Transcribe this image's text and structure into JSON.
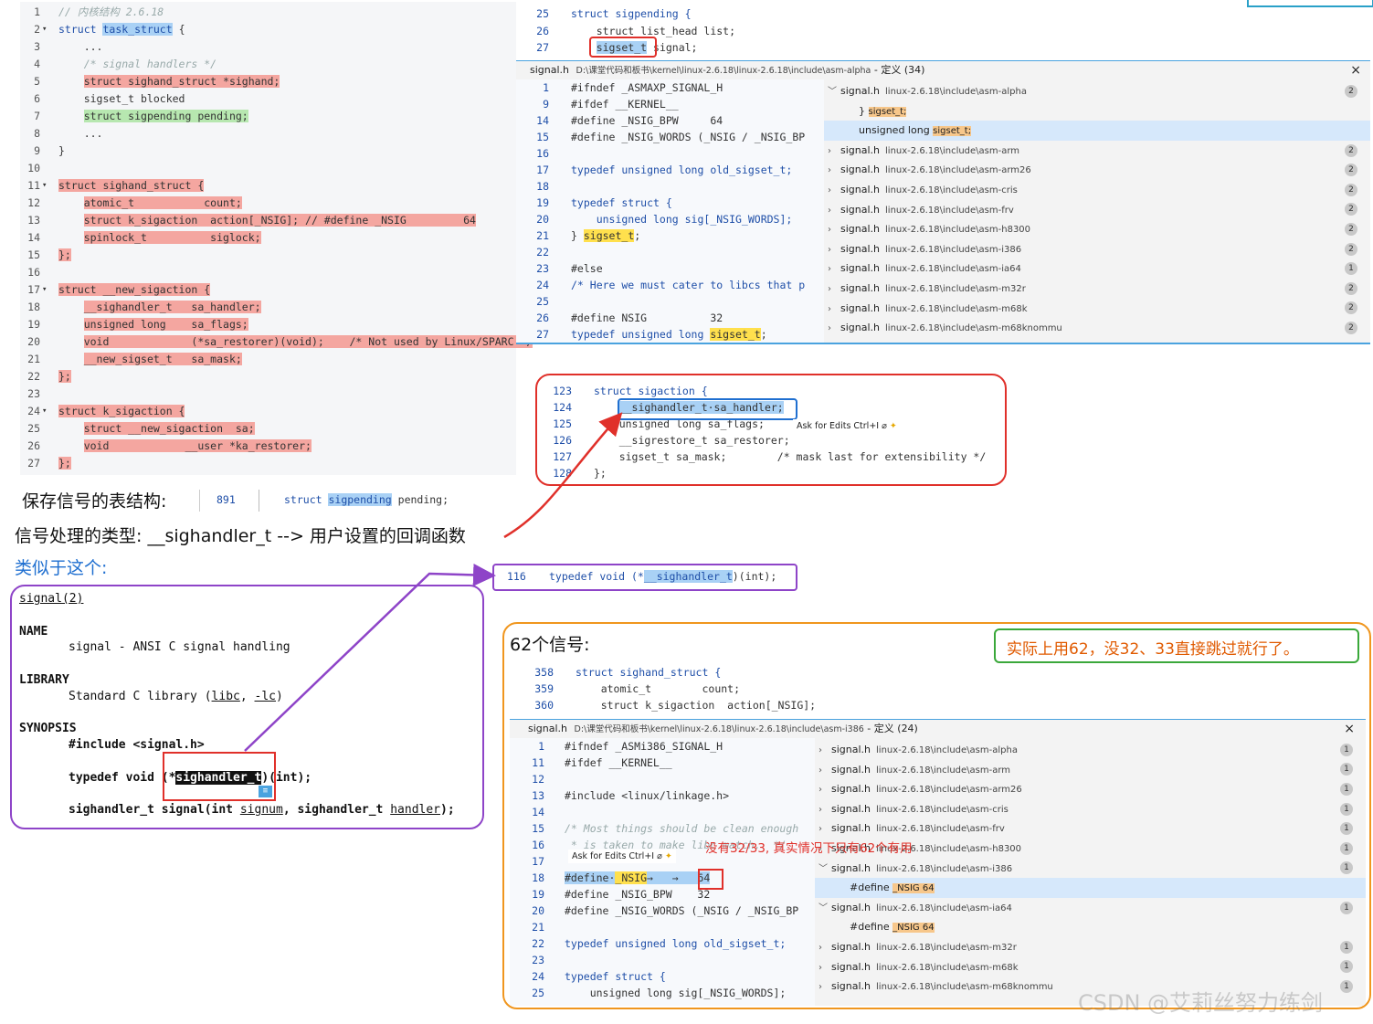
{
  "kernel_struct_panel": {
    "lines": [
      {
        "n": "1",
        "fold": "",
        "parts": [
          {
            "t": "// 内核结构 2.6.18",
            "c": "cm"
          }
        ]
      },
      {
        "n": "2",
        "fold": "▾",
        "parts": [
          {
            "t": "struct ",
            "c": "kw"
          },
          {
            "t": "task_struct",
            "c": "kw hl-blue"
          },
          {
            "t": " {",
            "c": ""
          }
        ]
      },
      {
        "n": "3",
        "fold": "",
        "parts": [
          {
            "t": "    ...",
            "c": ""
          }
        ]
      },
      {
        "n": "4",
        "fold": "",
        "parts": [
          {
            "t": "    /* signal handlers */",
            "c": "cm"
          }
        ]
      },
      {
        "n": "5",
        "fold": "",
        "parts": [
          {
            "t": "    ",
            "c": ""
          },
          {
            "t": "struct sighand_struct *sighand;",
            "c": "hl-red"
          }
        ]
      },
      {
        "n": "6",
        "fold": "",
        "parts": [
          {
            "t": "    sigset_t blocked",
            "c": ""
          }
        ]
      },
      {
        "n": "7",
        "fold": "",
        "parts": [
          {
            "t": "    ",
            "c": ""
          },
          {
            "t": "struct sigpending pending;",
            "c": "hl-green"
          }
        ]
      },
      {
        "n": "8",
        "fold": "",
        "parts": [
          {
            "t": "    ...",
            "c": ""
          }
        ]
      },
      {
        "n": "9",
        "fold": "",
        "parts": [
          {
            "t": "}",
            "c": ""
          }
        ]
      },
      {
        "n": "10",
        "fold": "",
        "parts": []
      },
      {
        "n": "11",
        "fold": "▾",
        "parts": [
          {
            "t": "struct sighand_struct {",
            "c": "hl-red"
          }
        ]
      },
      {
        "n": "12",
        "fold": "",
        "parts": [
          {
            "t": "    ",
            "c": ""
          },
          {
            "t": "atomic_t           count;",
            "c": "hl-red"
          }
        ]
      },
      {
        "n": "13",
        "fold": "",
        "parts": [
          {
            "t": "    ",
            "c": ""
          },
          {
            "t": "struct k_sigaction  action[_NSIG]; // #define _NSIG         64",
            "c": "hl-red"
          }
        ]
      },
      {
        "n": "14",
        "fold": "",
        "parts": [
          {
            "t": "    ",
            "c": ""
          },
          {
            "t": "spinlock_t          siglock;",
            "c": "hl-red"
          }
        ]
      },
      {
        "n": "15",
        "fold": "",
        "parts": [
          {
            "t": "};",
            "c": "hl-red"
          }
        ]
      },
      {
        "n": "16",
        "fold": "",
        "parts": []
      },
      {
        "n": "17",
        "fold": "▾",
        "parts": [
          {
            "t": "struct __new_sigaction {",
            "c": "hl-red"
          }
        ]
      },
      {
        "n": "18",
        "fold": "",
        "parts": [
          {
            "t": "    ",
            "c": ""
          },
          {
            "t": "__sighandler_t   sa_handler;",
            "c": "hl-red"
          }
        ]
      },
      {
        "n": "19",
        "fold": "",
        "parts": [
          {
            "t": "    ",
            "c": ""
          },
          {
            "t": "unsigned long    sa_flags;",
            "c": "hl-red"
          }
        ]
      },
      {
        "n": "20",
        "fold": "",
        "parts": [
          {
            "t": "    ",
            "c": ""
          },
          {
            "t": "void             (*sa_restorer)(void);    /* Not used by Linux/SPARC */",
            "c": "hl-red"
          }
        ]
      },
      {
        "n": "21",
        "fold": "",
        "parts": [
          {
            "t": "    ",
            "c": ""
          },
          {
            "t": "__new_sigset_t   sa_mask;",
            "c": "hl-red"
          }
        ]
      },
      {
        "n": "22",
        "fold": "",
        "parts": [
          {
            "t": "};",
            "c": "hl-red"
          }
        ]
      },
      {
        "n": "23",
        "fold": "",
        "parts": []
      },
      {
        "n": "24",
        "fold": "▾",
        "parts": [
          {
            "t": "struct k_sigaction {",
            "c": "hl-red"
          }
        ]
      },
      {
        "n": "25",
        "fold": "",
        "parts": [
          {
            "t": "    ",
            "c": ""
          },
          {
            "t": "struct __new_sigaction  sa;",
            "c": "hl-red"
          }
        ]
      },
      {
        "n": "26",
        "fold": "",
        "parts": [
          {
            "t": "    ",
            "c": ""
          },
          {
            "t": "void            __user *ka_restorer;",
            "c": "hl-red"
          }
        ]
      },
      {
        "n": "27",
        "fold": "",
        "parts": [
          {
            "t": "};",
            "c": "hl-red"
          }
        ]
      }
    ]
  },
  "sigpending_editor": {
    "lines": [
      {
        "n": "25",
        "parts": [
          {
            "t": "struct sigpending {",
            "c": "kw"
          }
        ]
      },
      {
        "n": "26",
        "parts": [
          {
            "t": "    struct list_head list;",
            "c": ""
          }
        ]
      },
      {
        "n": "27",
        "parts": [
          {
            "t": "    ",
            "c": ""
          },
          {
            "t": "sigset_t",
            "c": "hl-blue"
          },
          {
            "t": " signal;",
            "c": ""
          }
        ]
      }
    ]
  },
  "peek_alpha": {
    "file": "signal.h",
    "path": "D:\\课堂代码和板书\\kernel\\linux-2.6.18\\linux-2.6.18\\include\\asm-alpha",
    "definition": " - 定义 (34)",
    "close": "×",
    "code_lines": [
      {
        "n": "1",
        "parts": [
          {
            "t": "#ifndef _ASMAXP_SIGNAL_H",
            "c": ""
          }
        ]
      },
      {
        "n": "9",
        "parts": [
          {
            "t": "#ifdef __KERNEL__",
            "c": ""
          }
        ]
      },
      {
        "n": "14",
        "parts": [
          {
            "t": "#define _NSIG_BPW     64",
            "c": ""
          }
        ]
      },
      {
        "n": "15",
        "parts": [
          {
            "t": "#define _NSIG_WORDS (_NSIG / _NSIG_BP",
            "c": ""
          }
        ]
      },
      {
        "n": "16",
        "parts": []
      },
      {
        "n": "17",
        "parts": [
          {
            "t": "typedef unsigned long old_sigset_t;",
            "c": "kw"
          }
        ]
      },
      {
        "n": "18",
        "parts": []
      },
      {
        "n": "19",
        "parts": [
          {
            "t": "typedef struct {",
            "c": "kw"
          }
        ]
      },
      {
        "n": "20",
        "parts": [
          {
            "t": "    unsigned long sig[_NSIG_WORDS];",
            "c": "kw"
          }
        ]
      },
      {
        "n": "21",
        "parts": [
          {
            "t": "} ",
            "c": ""
          },
          {
            "t": "sigset_t",
            "c": "hl-yellow"
          },
          {
            "t": ";",
            "c": ""
          }
        ]
      },
      {
        "n": "22",
        "parts": []
      },
      {
        "n": "23",
        "parts": [
          {
            "t": "#else",
            "c": ""
          }
        ]
      },
      {
        "n": "24",
        "parts": [
          {
            "t": "/* Here we must cater to libcs that p",
            "c": "kw"
          }
        ]
      },
      {
        "n": "25",
        "parts": []
      },
      {
        "n": "26",
        "parts": [
          {
            "t": "#define NSIG          32",
            "c": ""
          }
        ]
      },
      {
        "n": "27",
        "parts": [
          {
            "t": "typedef unsigned long ",
            "c": "kw"
          },
          {
            "t": "sigset_t",
            "c": "hl-yellow"
          },
          {
            "t": ";",
            "c": ""
          }
        ]
      }
    ],
    "refs": [
      {
        "chev": "﹀",
        "file": "signal.h",
        "path": "linux-2.6.18\\include\\asm-alpha",
        "count": "2",
        "indent": 0
      },
      {
        "chev": "",
        "file": "} ",
        "path": "sigset_t;",
        "count": "",
        "indent": 1
      },
      {
        "chev": "",
        "file": "unsigned long ",
        "path": "sigset_t;",
        "count": "",
        "indent": 1
      },
      {
        "chev": "›",
        "file": "signal.h",
        "path": "linux-2.6.18\\include\\asm-arm",
        "count": "2",
        "indent": 0
      },
      {
        "chev": "›",
        "file": "signal.h",
        "path": "linux-2.6.18\\include\\asm-arm26",
        "count": "2",
        "indent": 0
      },
      {
        "chev": "›",
        "file": "signal.h",
        "path": "linux-2.6.18\\include\\asm-cris",
        "count": "2",
        "indent": 0
      },
      {
        "chev": "›",
        "file": "signal.h",
        "path": "linux-2.6.18\\include\\asm-frv",
        "count": "2",
        "indent": 0
      },
      {
        "chev": "›",
        "file": "signal.h",
        "path": "linux-2.6.18\\include\\asm-h8300",
        "count": "2",
        "indent": 0
      },
      {
        "chev": "›",
        "file": "signal.h",
        "path": "linux-2.6.18\\include\\asm-i386",
        "count": "2",
        "indent": 0
      },
      {
        "chev": "›",
        "file": "signal.h",
        "path": "linux-2.6.18\\include\\asm-ia64",
        "count": "1",
        "indent": 0
      },
      {
        "chev": "›",
        "file": "signal.h",
        "path": "linux-2.6.18\\include\\asm-m32r",
        "count": "2",
        "indent": 0
      },
      {
        "chev": "›",
        "file": "signal.h",
        "path": "linux-2.6.18\\include\\asm-m68k",
        "count": "2",
        "indent": 0
      },
      {
        "chev": "›",
        "file": "signal.h",
        "path": "linux-2.6.18\\include\\asm-m68knommu",
        "count": "2",
        "indent": 0
      }
    ]
  },
  "sigaction_editor": {
    "lines": [
      {
        "n": "123",
        "parts": [
          {
            "t": "struct sigaction {",
            "c": "kw"
          }
        ]
      },
      {
        "n": "124",
        "parts": [
          {
            "t": "    ",
            "c": ""
          },
          {
            "t": "__sighandler_t·sa_handler;",
            "c": "hl-blue"
          }
        ]
      },
      {
        "n": "125",
        "parts": [
          {
            "t": "    unsigned long sa_flags;",
            "c": ""
          }
        ]
      },
      {
        "n": "126",
        "parts": [
          {
            "t": "    __sigrestore_t sa_restorer;",
            "c": ""
          }
        ]
      },
      {
        "n": "127",
        "parts": [
          {
            "t": "    sigset_t sa_mask;        /* mask last for extensibility */",
            "c": ""
          }
        ]
      },
      {
        "n": "128",
        "parts": [
          {
            "t": "};",
            "c": ""
          }
        ]
      }
    ],
    "ask_for_edits": "Ask for Edits Ctrl+I"
  },
  "captions": {
    "table_structure": "保存信号的表结构:",
    "handler_type": "信号处理的类型:  __sighandler_t --> 用户设置的回调函数",
    "similar": "类似于这个:",
    "sixty_two": "62个信号:",
    "actual": "实际上用62，没32、33直接跳过就行了。",
    "note_red": "没有32/33, 真实情况下只有62个有用"
  },
  "pending_line": {
    "n": "891",
    "before": "struct ",
    "hl": "sigpending",
    "after": " pending;"
  },
  "typedef_line": {
    "n": "116",
    "before": "typedef void (*",
    "hl": "__sighandler_t",
    "after": ")(int);"
  },
  "man_page": {
    "title": "signal(2)",
    "name_h": "NAME",
    "name_v": "signal - ANSI C signal handling",
    "lib_h": "LIBRARY",
    "lib_v1": "Standard C library (",
    "lib_libc": "libc",
    "lib_mid": ", ",
    "lib_lc": "-lc",
    "lib_end": ")",
    "syn_h": "SYNOPSIS",
    "include": "#include <signal.h>",
    "td_before": "typedef void (*",
    "td_hl": "sighandler_t",
    "td_after": ")(int);",
    "sig_before": "sighandler_t signal(int ",
    "sig_signum": "signum",
    "sig_mid": ", sighandler_t ",
    "sig_handler": "handler",
    "sig_end": ");"
  },
  "sighand_editor": {
    "lines": [
      {
        "n": "358",
        "parts": [
          {
            "t": "struct sighand_struct {",
            "c": "kw"
          }
        ]
      },
      {
        "n": "359",
        "parts": [
          {
            "t": "    atomic_t        count;",
            "c": ""
          }
        ]
      },
      {
        "n": "360",
        "parts": [
          {
            "t": "    struct k_sigaction  action[_NSIG];",
            "c": ""
          }
        ]
      }
    ]
  },
  "peek_i386": {
    "file": "signal.h",
    "path": "D:\\课堂代码和板书\\kernel\\linux-2.6.18\\linux-2.6.18\\include\\asm-i386",
    "definition": " - 定义 (24)",
    "close": "×",
    "code_lines": [
      {
        "n": "1",
        "parts": [
          {
            "t": "#ifndef _ASMi386_SIGNAL_H",
            "c": ""
          }
        ]
      },
      {
        "n": "11",
        "parts": [
          {
            "t": "#ifdef __KERNEL__",
            "c": ""
          }
        ]
      },
      {
        "n": "12",
        "parts": []
      },
      {
        "n": "13",
        "parts": [
          {
            "t": "#include <linux/linkage.h>",
            "c": ""
          }
        ]
      },
      {
        "n": "14",
        "parts": []
      },
      {
        "n": "15",
        "parts": [
          {
            "t": "/* Most things should be clean enough",
            "c": "cm"
          }
        ]
      },
      {
        "n": "16",
        "parts": [
          {
            "t": " * is taken to make libc match.  */",
            "c": "cm"
          }
        ]
      },
      {
        "n": "17",
        "parts": []
      },
      {
        "n": "18",
        "parts": [
          {
            "t": "#define·",
            "c": "hl-blue"
          },
          {
            "t": "_NSIG",
            "c": "hl-yellow"
          },
          {
            "t": "→   →   ",
            "c": "hl-blue"
          },
          {
            "t": "64",
            "c": "hl-blue"
          }
        ]
      },
      {
        "n": "19",
        "parts": [
          {
            "t": "#define _NSIG_BPW    32",
            "c": ""
          }
        ]
      },
      {
        "n": "20",
        "parts": [
          {
            "t": "#define _NSIG_WORDS (_NSIG / _NSIG_BP",
            "c": ""
          }
        ]
      },
      {
        "n": "21",
        "parts": []
      },
      {
        "n": "22",
        "parts": [
          {
            "t": "typedef unsigned long old_sigset_t;",
            "c": "kw"
          }
        ]
      },
      {
        "n": "23",
        "parts": []
      },
      {
        "n": "24",
        "parts": [
          {
            "t": "typedef struct {",
            "c": "kw"
          }
        ]
      },
      {
        "n": "25",
        "parts": [
          {
            "t": "    unsigned long sig[_NSIG_WORDS];",
            "c": ""
          }
        ]
      }
    ],
    "ask_for_edits": "Ask for Edits Ctrl+I",
    "refs": [
      {
        "chev": "›",
        "file": "signal.h",
        "path": "linux-2.6.18\\include\\asm-alpha",
        "count": "1",
        "indent": 0
      },
      {
        "chev": "›",
        "file": "signal.h",
        "path": "linux-2.6.18\\include\\asm-arm",
        "count": "1",
        "indent": 0
      },
      {
        "chev": "›",
        "file": "signal.h",
        "path": "linux-2.6.18\\include\\asm-arm26",
        "count": "1",
        "indent": 0
      },
      {
        "chev": "›",
        "file": "signal.h",
        "path": "linux-2.6.18\\include\\asm-cris",
        "count": "1",
        "indent": 0
      },
      {
        "chev": "›",
        "file": "signal.h",
        "path": "linux-2.6.18\\include\\asm-frv",
        "count": "1",
        "indent": 0
      },
      {
        "chev": "›",
        "file": "signal.h",
        "path": "linux-2.6.18\\include\\asm-h8300",
        "count": "1",
        "indent": 0
      },
      {
        "chev": "﹀",
        "file": "signal.h",
        "path": "linux-2.6.18\\include\\asm-i386",
        "count": "1",
        "indent": 0
      },
      {
        "chev": "",
        "file": "#define ",
        "path": "_NSIG 64",
        "count": "",
        "indent": 1
      },
      {
        "chev": "﹀",
        "file": "signal.h",
        "path": "linux-2.6.18\\include\\asm-ia64",
        "count": "1",
        "indent": 0
      },
      {
        "chev": "",
        "file": "#define ",
        "path": "_NSIG 64",
        "count": "",
        "indent": 1
      },
      {
        "chev": "›",
        "file": "signal.h",
        "path": "linux-2.6.18\\include\\asm-m32r",
        "count": "1",
        "indent": 0
      },
      {
        "chev": "›",
        "file": "signal.h",
        "path": "linux-2.6.18\\include\\asm-m68k",
        "count": "1",
        "indent": 0
      },
      {
        "chev": "›",
        "file": "signal.h",
        "path": "linux-2.6.18\\include\\asm-m68knommu",
        "count": "1",
        "indent": 0
      }
    ]
  },
  "watermark": "CSDN @艾莉丝努力练剑",
  "colors": {
    "red_box": "#e0302a",
    "purple_box": "#8e44c8",
    "orange_box": "#f0961e",
    "green_box": "#3aa83a",
    "blue_link": "#1f6fd0",
    "highlight_red": "#f4a6a0"
  }
}
